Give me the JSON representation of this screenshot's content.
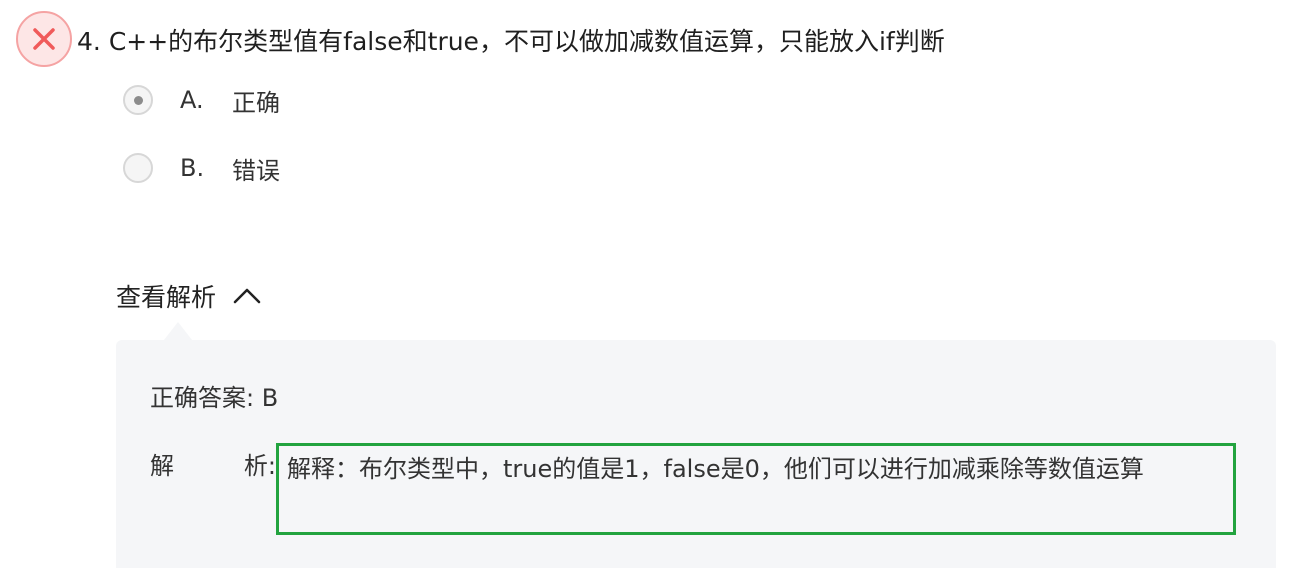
{
  "question": {
    "result": "incorrect",
    "number": "4.",
    "text": "C++的布尔类型值有false和true，不可以做加减数值运算，只能放入if判断",
    "icons": {
      "result_icon": "close-icon",
      "result_color": "#f05a5a"
    }
  },
  "options": [
    {
      "key": "A.",
      "label": "正确",
      "selected": true
    },
    {
      "key": "B.",
      "label": "错误",
      "selected": false
    }
  ],
  "analysis": {
    "toggle_label": "查看解析",
    "expanded": true,
    "toggle_icon": "chevron-up-icon",
    "answer_prefix": "正确答案:",
    "answer_value": "B",
    "explain_label_a": "解",
    "explain_label_b": "析:",
    "explain_text": "解释：布尔类型中，true的值是1，false是0，他们可以进行加减乘除等数值运算",
    "highlight_color": "#22a33f"
  }
}
